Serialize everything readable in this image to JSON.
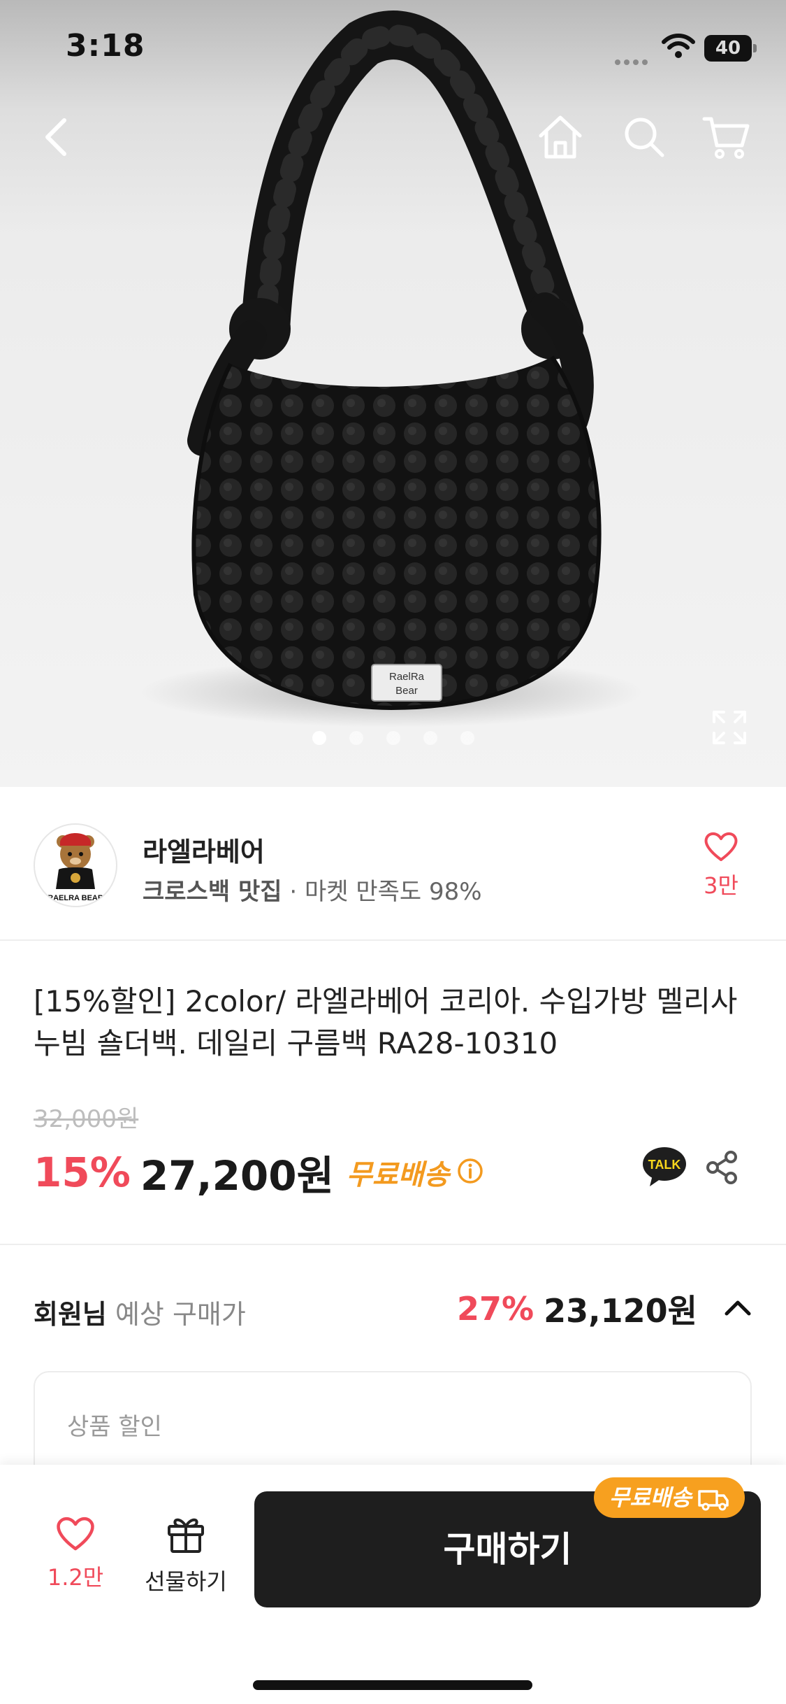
{
  "status_bar": {
    "time": "3:18",
    "battery": "40"
  },
  "nav": {
    "back_icon": "chevron-left-icon",
    "home_icon": "home-icon",
    "search_icon": "search-icon",
    "cart_icon": "cart-icon"
  },
  "gallery": {
    "image_count": 5,
    "active_index": 0,
    "label_line1": "RaelRa",
    "label_line2": "Bear"
  },
  "seller": {
    "name": "라엘라베어",
    "category": "크로스백 맛집",
    "satisfaction": " · 마켓 만족도 98%",
    "avatar_text": "RAELRA BEAR",
    "likes": "3만"
  },
  "product": {
    "title": "[15%할인] 2color/ 라엘라베어 코리아. 수입가방 멜리사 누빔 숄더백. 데일리 구름백 RA28-10310",
    "original_price": "32,000원",
    "discount": "15%",
    "price": "27,200원",
    "free_shipping": "무료배송",
    "talk_label": "TALK"
  },
  "member": {
    "label_bold": "회원님",
    "label_rest": " 예상 구매가",
    "discount": "27%",
    "price": "23,120원",
    "discount_box_label": "상품 할인"
  },
  "bottom": {
    "like_count": "1.2만",
    "gift_label": "선물하기",
    "buy_label": "구매하기",
    "badge_label": "무료배송"
  },
  "colors": {
    "accent_red": "#f04a5a",
    "accent_orange": "#f39a1f",
    "button_dark": "#1e1e1e"
  }
}
